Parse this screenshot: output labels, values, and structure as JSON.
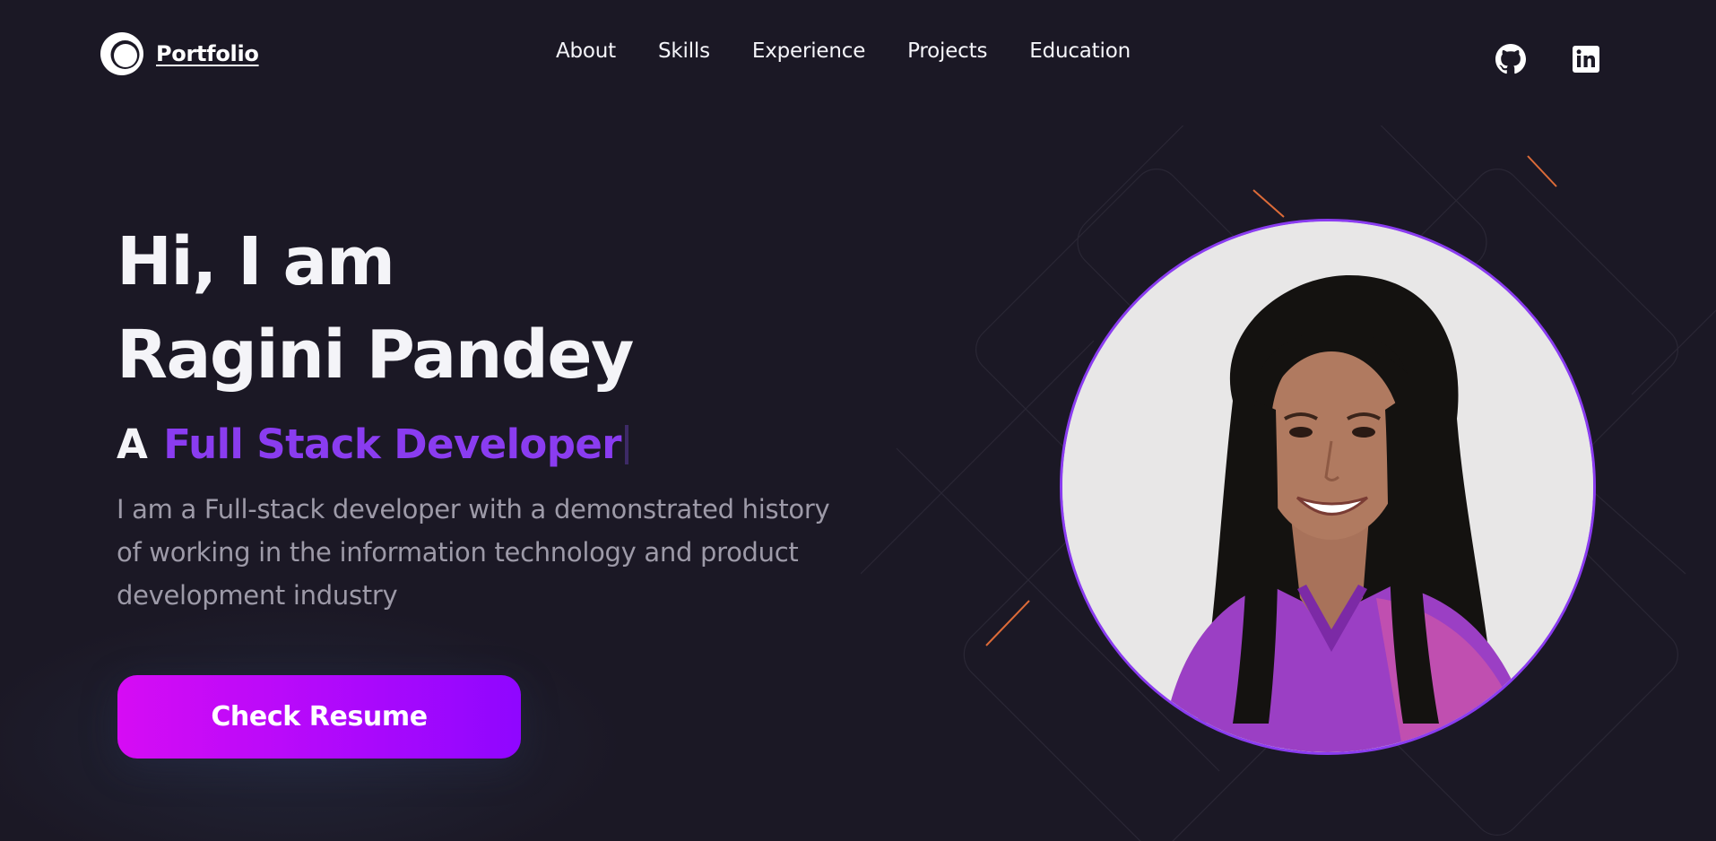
{
  "brand": {
    "name": "Portfolio",
    "logo_icon": "crescent-circle-icon"
  },
  "nav": {
    "links": [
      "About",
      "Skills",
      "Experience",
      "Projects",
      "Education"
    ]
  },
  "social": {
    "github_icon": "github-icon",
    "linkedin_icon": "linkedin-icon"
  },
  "hero": {
    "greeting": "Hi, I am",
    "name": "Ragini Pandey",
    "role_prefix": "A",
    "role": "Full Stack Developer",
    "description": "I am a Full-stack developer with a demonstrated history of working in the information technology and product development industry",
    "cta_label": "Check Resume"
  },
  "colors": {
    "background": "#1b1825",
    "accent_purple": "#8a3cf0",
    "button_gradient_start": "#d60cf4",
    "button_gradient_end": "#8f06ff",
    "muted_text": "#9d9aa8"
  }
}
